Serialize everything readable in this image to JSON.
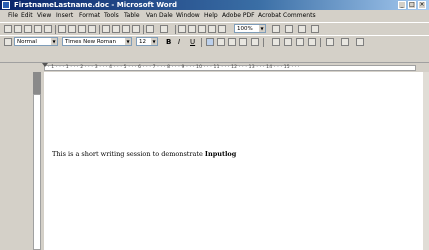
{
  "window": {
    "title": "FirstnameLastname.doc - Microsoft Word",
    "controls": [
      "_",
      "□",
      "×"
    ]
  },
  "menu": [
    {
      "label": "File"
    },
    {
      "label": "Edit"
    },
    {
      "label": "View"
    },
    {
      "label": "Insert"
    },
    {
      "label": "Format"
    },
    {
      "label": "Tools"
    },
    {
      "label": "Table"
    },
    {
      "label": "Van Dale"
    },
    {
      "label": "Window"
    },
    {
      "label": "Help"
    },
    {
      "label": "Adobe PDF"
    },
    {
      "label": "Acrobat Comments"
    }
  ],
  "standard_toolbar": {
    "zoom": "100%"
  },
  "formatting_toolbar": {
    "style": "Normal",
    "font": "Times New Roman",
    "size": "12",
    "bold": "B",
    "italic": "I",
    "underline": "U"
  },
  "ruler_labels": "· 1 · · · 1 · · · 2 · · · 3 · · · 4 · · · 5 · · · 6 · · · 7 · · · 8 · · · 9 · · · 10 · · · 11 · · · 12 · · · 13 · · · 14 · · · 15 · · ·",
  "document": {
    "text": "This is a short writing session to demonstrate ",
    "bold_text": "Inputlog"
  }
}
